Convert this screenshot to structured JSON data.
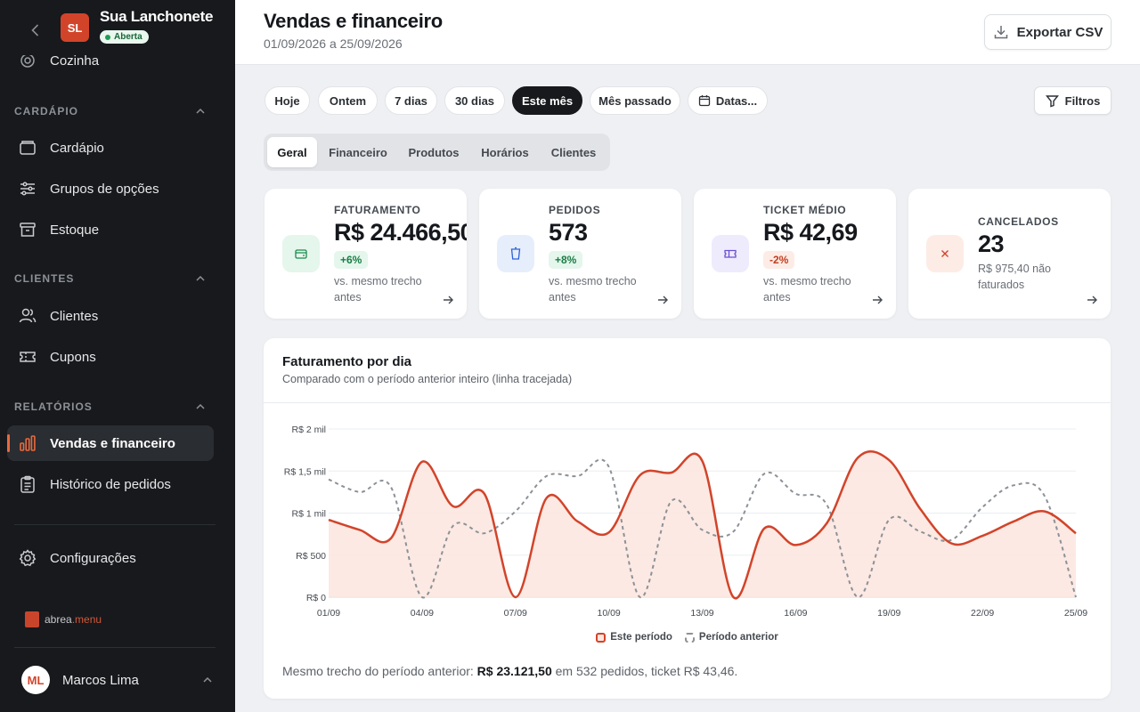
{
  "store": {
    "initials": "SL",
    "name": "Sua Lanchonete",
    "status": "Aberta"
  },
  "sidebar": {
    "partial_item": "Cozinha",
    "sections": {
      "cardapio": "CARDÁPIO",
      "clientes": "CLIENTES",
      "relatorios": "RELATÓRIOS"
    },
    "items": {
      "cardapio": "Cardápio",
      "grupos": "Grupos de opções",
      "estoque": "Estoque",
      "clientes": "Clientes",
      "cupons": "Cupons",
      "vendas": "Vendas e financeiro",
      "historico": "Histórico de pedidos",
      "config": "Configurações"
    },
    "brand": {
      "prefix": "abrea",
      "suffix": ".menu"
    },
    "user": {
      "initials": "ML",
      "name": "Marcos Lima"
    }
  },
  "header": {
    "title": "Vendas e financeiro",
    "date_range": "01/09/2026 a 25/09/2026",
    "export_label": "Exportar CSV"
  },
  "period_chips": [
    "Hoje",
    "Ontem",
    "7 dias",
    "30 dias",
    "Este mês",
    "Mês passado",
    "Datas..."
  ],
  "selected_chip": "Este mês",
  "filters_label": "Filtros",
  "tabs": [
    "Geral",
    "Financeiro",
    "Produtos",
    "Horários",
    "Clientes"
  ],
  "selected_tab": "Geral",
  "kpis": [
    {
      "label": "FATURAMENTO",
      "value": "R$ 24.466,50",
      "delta": "+6%",
      "trend": "up",
      "note": "vs. mesmo trecho antes",
      "icon": "wallet-icon"
    },
    {
      "label": "PEDIDOS",
      "value": "573",
      "delta": "+8%",
      "trend": "up",
      "note": "vs. mesmo trecho antes",
      "icon": "cup-icon"
    },
    {
      "label": "TICKET MÉDIO",
      "value": "R$ 42,69",
      "delta": "-2%",
      "trend": "down",
      "note": "vs. mesmo trecho antes",
      "icon": "ticket-icon"
    },
    {
      "label": "CANCELADOS",
      "value": "23",
      "note": "R$ 975,40 não faturados",
      "icon": "x-icon"
    }
  ],
  "colors": {
    "accent": "#d2442a",
    "previous": "#8d9197",
    "fill": "#fbe5de"
  },
  "chart_panel": {
    "title": "Faturamento por dia",
    "subtitle": "Comparado com o período anterior inteiro (linha tracejada)",
    "footnote_prefix": "Mesmo trecho do período anterior:",
    "footnote_value": "R$ 23.121,50",
    "footnote_suffix": "em 532 pedidos, ticket R$ 43,46."
  },
  "chart_data": {
    "type": "area",
    "x": [
      "01/09",
      "02/09",
      "03/09",
      "04/09",
      "05/09",
      "06/09",
      "07/09",
      "08/09",
      "09/09",
      "10/09",
      "11/09",
      "12/09",
      "13/09",
      "14/09",
      "15/09",
      "16/09",
      "17/09",
      "18/09",
      "19/09",
      "20/09",
      "21/09",
      "22/09",
      "23/09",
      "24/09",
      "25/09"
    ],
    "x_tick_labels": [
      "01/09",
      "04/09",
      "07/09",
      "10/09",
      "13/09",
      "16/09",
      "19/09",
      "22/09",
      "25/09"
    ],
    "y_tick_labels": [
      "R$ 0",
      "R$ 500",
      "R$ 1 mil",
      "R$ 1,5 mil",
      "R$ 2 mil"
    ],
    "ylim": [
      0,
      2000
    ],
    "grid": true,
    "legend_position": "bottom",
    "series": [
      {
        "name": "Este período",
        "style": "solid-area",
        "values": [
          920,
          800,
          700,
          1610,
          1080,
          1230,
          0,
          1180,
          900,
          770,
          1450,
          1480,
          1620,
          0,
          820,
          620,
          880,
          1660,
          1630,
          1050,
          640,
          730,
          900,
          1020,
          760
        ]
      },
      {
        "name": "Período anterior",
        "style": "dashed",
        "values": [
          1400,
          1250,
          1310,
          0,
          850,
          760,
          1020,
          1440,
          1440,
          1550,
          0,
          1140,
          800,
          780,
          1470,
          1230,
          1100,
          0,
          920,
          780,
          680,
          1070,
          1330,
          1200,
          0
        ]
      }
    ]
  }
}
